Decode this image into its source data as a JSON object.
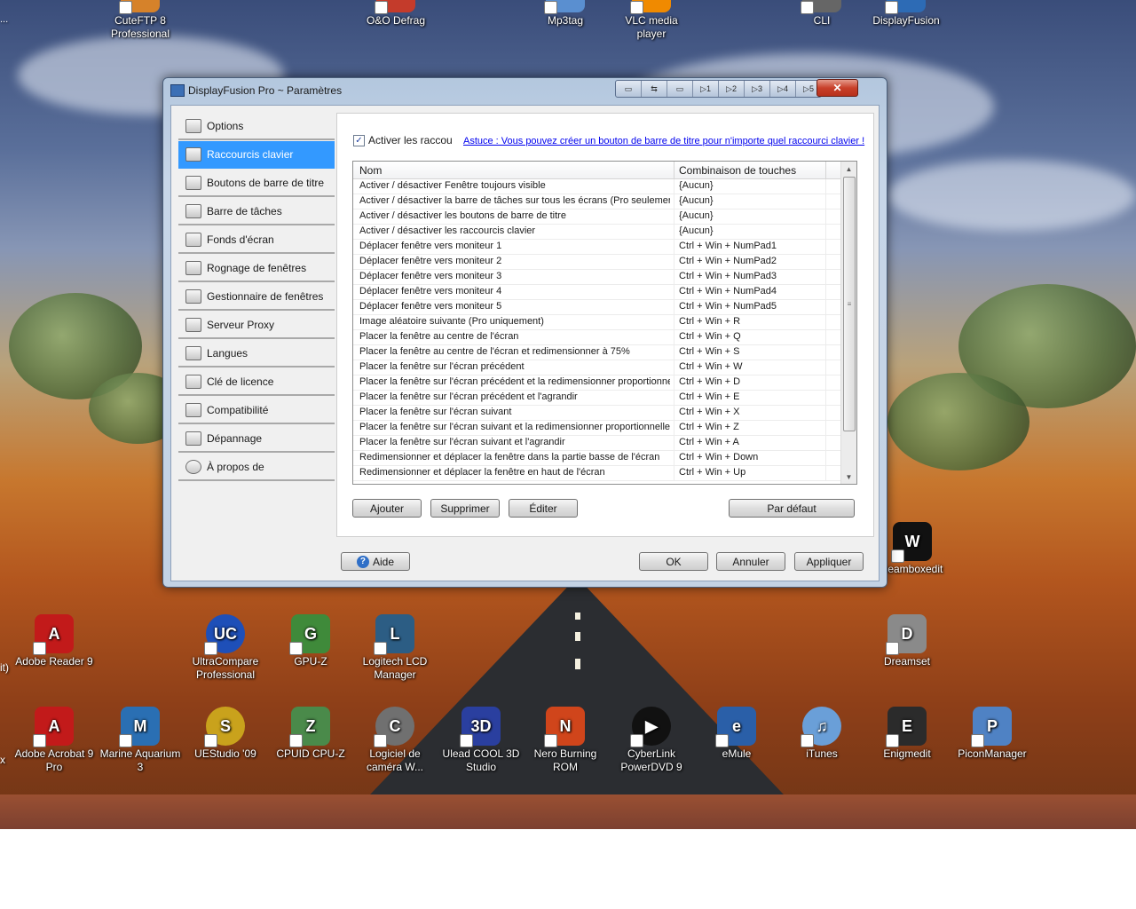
{
  "desktop": {
    "top_icons": [
      {
        "label": "CuteFTP 8 Professional",
        "color": "#d6822a"
      },
      {
        "label": "O&O Defrag",
        "color": "#c43b2b"
      },
      {
        "label": "Mp3tag",
        "color": "#5a8fd0"
      },
      {
        "label": "VLC media player",
        "color": "#f08a00"
      },
      {
        "label": "CLI",
        "color": "#666666"
      },
      {
        "label": "DisplayFusion",
        "color": "#2d6bb5"
      }
    ],
    "icons": [
      {
        "label": "Adobe Reader 9",
        "color": "#c21a1a",
        "glyph": "A"
      },
      {
        "label": "UltraCompare Professional",
        "color": "#1e4fb8",
        "glyph": "UC"
      },
      {
        "label": "GPU-Z",
        "color": "#3f8a3a",
        "glyph": "G"
      },
      {
        "label": "Logitech LCD Manager",
        "color": "#2c5d84",
        "glyph": "L"
      },
      {
        "label": "beamboxedit",
        "color": "#111111",
        "glyph": "W"
      },
      {
        "label": "Dreamset",
        "color": "#8a8a8a",
        "glyph": "D"
      },
      {
        "label": "Adobe Acrobat 9 Pro",
        "color": "#c21a1a",
        "glyph": "A"
      },
      {
        "label": "Marine Aquarium 3",
        "color": "#2a6fb3",
        "glyph": "M"
      },
      {
        "label": "UEStudio '09",
        "color": "#c9a21c",
        "glyph": "S"
      },
      {
        "label": "CPUID CPU-Z",
        "color": "#4a8a4a",
        "glyph": "Z"
      },
      {
        "label": "Logiciel de caméra W...",
        "color": "#707070",
        "glyph": "C"
      },
      {
        "label": "Ulead COOL 3D Studio",
        "color": "#2a3f9f",
        "glyph": "3D"
      },
      {
        "label": "Nero Burning ROM",
        "color": "#d0451b",
        "glyph": "N"
      },
      {
        "label": "CyberLink PowerDVD 9",
        "color": "#111111",
        "glyph": "▶"
      },
      {
        "label": "eMule",
        "color": "#2a5fa8",
        "glyph": "e"
      },
      {
        "label": "iTunes",
        "color": "#6a9fd8",
        "glyph": "♫"
      },
      {
        "label": "Enigmedit",
        "color": "#2b2b2b",
        "glyph": "E"
      },
      {
        "label": "PiconManager",
        "color": "#4f82c4",
        "glyph": "P"
      }
    ],
    "edge_labels": {
      "left1": "it)",
      "left2": "x",
      "left_top": "..."
    }
  },
  "window": {
    "title": "DisplayFusion Pro ~ Paramètres",
    "titlebar_buttons": [
      "▭",
      "⇆",
      "▭",
      "▷1",
      "▷2",
      "▷3",
      "▷4",
      "▷5"
    ],
    "close_glyph": "✕",
    "nav": [
      {
        "label": "Options",
        "selected": false
      },
      {
        "label": "Raccourcis clavier",
        "selected": true
      },
      {
        "label": "Boutons de barre de titre",
        "selected": false
      },
      {
        "label": "Barre de tâches",
        "selected": false
      },
      {
        "label": "Fonds d'écran",
        "selected": false
      },
      {
        "label": "Rognage de fenêtres",
        "selected": false
      },
      {
        "label": "Gestionnaire de fenêtres",
        "selected": false
      },
      {
        "label": "Serveur Proxy",
        "selected": false
      },
      {
        "label": "Langues",
        "selected": false
      },
      {
        "label": "Clé de licence",
        "selected": false
      },
      {
        "label": "Compatibilité",
        "selected": false
      },
      {
        "label": "Dépannage",
        "selected": false
      },
      {
        "label": "À propos de",
        "selected": false
      }
    ],
    "enable_checkbox": {
      "checked": true,
      "label": "Activer les raccou"
    },
    "tip_link": "Astuce : Vous pouvez créer un bouton de barre de titre pour n'importe quel raccourci clavier !",
    "table": {
      "columns": [
        "Nom",
        "Combinaison de touches"
      ],
      "rows": [
        [
          "Activer / désactiver Fenêtre toujours visible",
          "{Aucun}"
        ],
        [
          "Activer / désactiver la barre de tâches sur tous les écrans (Pro seulement)",
          "{Aucun}"
        ],
        [
          "Activer / désactiver les boutons de barre de titre",
          "{Aucun}"
        ],
        [
          "Activer / désactiver les raccourcis clavier",
          "{Aucun}"
        ],
        [
          "Déplacer fenêtre vers moniteur 1",
          "Ctrl + Win + NumPad1"
        ],
        [
          "Déplacer fenêtre vers moniteur 2",
          "Ctrl + Win + NumPad2"
        ],
        [
          "Déplacer fenêtre vers moniteur 3",
          "Ctrl + Win + NumPad3"
        ],
        [
          "Déplacer fenêtre vers moniteur 4",
          "Ctrl + Win + NumPad4"
        ],
        [
          "Déplacer fenêtre vers moniteur 5",
          "Ctrl + Win + NumPad5"
        ],
        [
          "Image aléatoire suivante (Pro uniquement)",
          "Ctrl + Win + R"
        ],
        [
          "Placer la fenêtre au centre de l'écran",
          "Ctrl + Win + Q"
        ],
        [
          "Placer la fenêtre au centre de l'écran et redimensionner à 75%",
          "Ctrl + Win + S"
        ],
        [
          "Placer la fenêtre sur l'écran précédent",
          "Ctrl + Win + W"
        ],
        [
          "Placer la fenêtre sur l'écran précédent et la redimensionner proportionnel...",
          "Ctrl + Win + D"
        ],
        [
          "Placer la fenêtre sur l'écran précédent et l'agrandir",
          "Ctrl + Win + E"
        ],
        [
          "Placer la fenêtre sur l'écran suivant",
          "Ctrl + Win + X"
        ],
        [
          "Placer la fenêtre sur l'écran suivant et la redimensionner proportionnelle...",
          "Ctrl + Win + Z"
        ],
        [
          "Placer la fenêtre sur l'écran suivant et l'agrandir",
          "Ctrl + Win + A"
        ],
        [
          "Redimensionner et déplacer la fenêtre dans la partie basse de l'écran",
          "Ctrl + Win + Down"
        ],
        [
          "Redimensionner et déplacer la fenêtre en haut de l'écran",
          "Ctrl + Win + Up"
        ]
      ]
    },
    "panel_buttons": {
      "add": "Ajouter",
      "delete": "Supprimer",
      "edit": "Éditer",
      "default": "Par défaut"
    },
    "footer_buttons": {
      "help": "Aide",
      "ok": "OK",
      "cancel": "Annuler",
      "apply": "Appliquer"
    }
  }
}
